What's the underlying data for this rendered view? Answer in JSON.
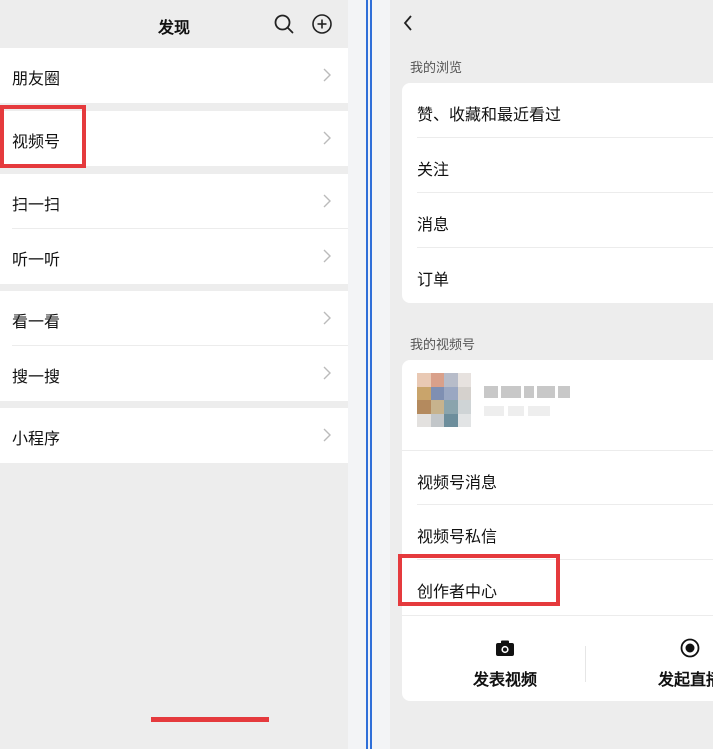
{
  "discover": {
    "title": "发现",
    "header_icons": [
      "search-icon",
      "add-circle-icon"
    ],
    "groups": [
      {
        "items": [
          {
            "label": "朋友圈"
          }
        ]
      },
      {
        "items": [
          {
            "label": "视频号",
            "highlighted": true
          }
        ]
      },
      {
        "items": [
          {
            "label": "扫一扫"
          },
          {
            "label": "听一听"
          }
        ]
      },
      {
        "items": [
          {
            "label": "看一看"
          },
          {
            "label": "搜一搜"
          }
        ]
      },
      {
        "items": [
          {
            "label": "小程序"
          }
        ]
      }
    ]
  },
  "channels": {
    "back_icon": "chevron-left-icon",
    "browse_section": {
      "title": "我的浏览",
      "items": [
        {
          "label": "赞、收藏和最近看过"
        },
        {
          "label": "关注"
        },
        {
          "label": "消息"
        },
        {
          "label": "订单"
        }
      ]
    },
    "my_channel_section": {
      "title": "我的视频号",
      "profile": {
        "name_blurred": true
      },
      "items": [
        {
          "label": "视频号消息"
        },
        {
          "label": "视频号私信"
        },
        {
          "label": "创作者中心",
          "highlighted": true
        }
      ],
      "actions": [
        {
          "label": "发表视频",
          "icon": "camera-icon"
        },
        {
          "label": "发起直播",
          "icon": "record-icon"
        }
      ]
    }
  },
  "colors": {
    "highlight_border": "#e53a3d",
    "divider_blue": "#2f6fd8",
    "page_background": "#ededed"
  }
}
